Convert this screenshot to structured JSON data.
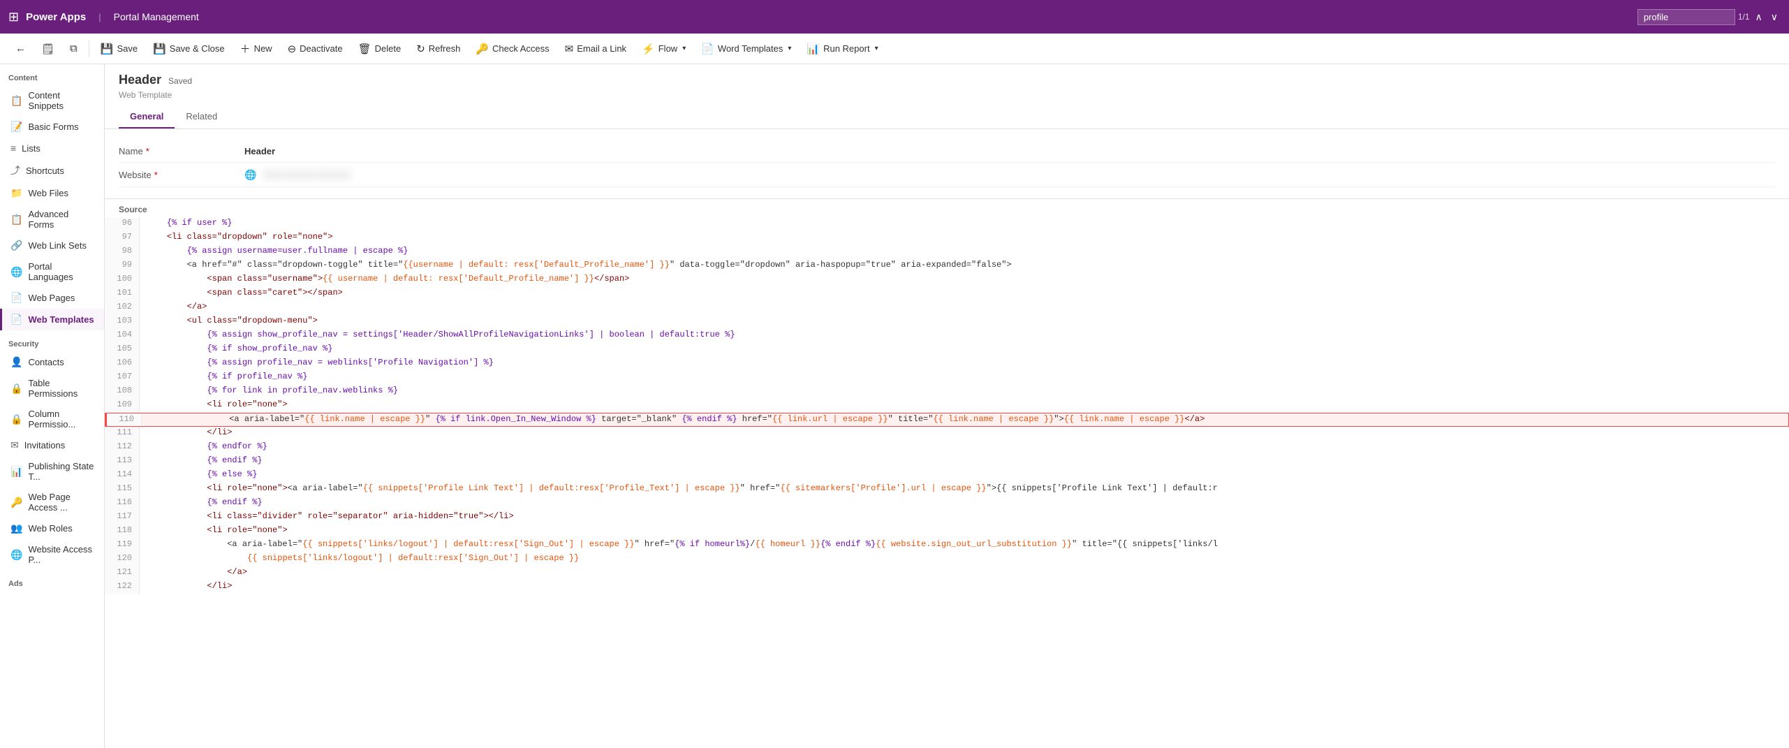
{
  "topBar": {
    "appsIcon": "⊞",
    "appName": "Power Apps",
    "separator": "|",
    "entityName": "Portal Management",
    "searchPlaceholder": "profile",
    "searchCount": "1/1"
  },
  "toolbar": {
    "back": "←",
    "notepad": "📄",
    "popout": "⧉",
    "save": "Save",
    "saveClose": "Save & Close",
    "new": "New",
    "deactivate": "Deactivate",
    "delete": "Delete",
    "refresh": "Refresh",
    "checkAccess": "Check Access",
    "emailLink": "Email a Link",
    "flow": "Flow",
    "wordTemplates": "Word Templates",
    "runReport": "Run Report"
  },
  "sidebar": {
    "contentSection": "Content",
    "items": [
      {
        "id": "content-snippets",
        "label": "Content Snippets",
        "icon": "📋"
      },
      {
        "id": "basic-forms",
        "label": "Basic Forms",
        "icon": "📝"
      },
      {
        "id": "lists",
        "label": "Lists",
        "icon": "≡"
      },
      {
        "id": "shortcuts",
        "label": "Shortcuts",
        "icon": "⤴"
      },
      {
        "id": "web-files",
        "label": "Web Files",
        "icon": "📁"
      },
      {
        "id": "advanced-forms",
        "label": "Advanced Forms",
        "icon": "📋"
      },
      {
        "id": "web-link-sets",
        "label": "Web Link Sets",
        "icon": "🔗"
      },
      {
        "id": "portal-languages",
        "label": "Portal Languages",
        "icon": "🌐"
      },
      {
        "id": "web-pages",
        "label": "Web Pages",
        "icon": "📄"
      },
      {
        "id": "web-templates",
        "label": "Web Templates",
        "icon": "📄",
        "active": true
      }
    ],
    "securitySection": "Security",
    "securityItems": [
      {
        "id": "contacts",
        "label": "Contacts",
        "icon": "👤"
      },
      {
        "id": "table-permissions",
        "label": "Table Permissions",
        "icon": "🔒"
      },
      {
        "id": "column-permissions",
        "label": "Column Permissio...",
        "icon": "🔒"
      },
      {
        "id": "invitations",
        "label": "Invitations",
        "icon": "✉"
      },
      {
        "id": "publishing-state",
        "label": "Publishing State T...",
        "icon": "📊"
      },
      {
        "id": "web-page-access",
        "label": "Web Page Access ...",
        "icon": "🔑"
      },
      {
        "id": "web-roles",
        "label": "Web Roles",
        "icon": "👥"
      },
      {
        "id": "website-access",
        "label": "Website Access P...",
        "icon": "🌐"
      }
    ],
    "adsSection": "Ads"
  },
  "record": {
    "title": "Header",
    "savedBadge": "Saved",
    "subtitle": "Web Template",
    "tabs": [
      "General",
      "Related"
    ],
    "activeTab": "General"
  },
  "form": {
    "nameLabel": "Name",
    "nameRequired": true,
    "nameValue": "Header",
    "websiteLabel": "Website",
    "websiteRequired": true,
    "websiteValue": "--- ------- -------"
  },
  "source": {
    "label": "Source",
    "lines": [
      {
        "num": 96,
        "content": "    {% if user %}",
        "highlight": false
      },
      {
        "num": 97,
        "content": "    <li class=\"dropdown\" role=\"none\">",
        "highlight": false
      },
      {
        "num": 98,
        "content": "        {% assign username=user.fullname | escape %}",
        "highlight": false
      },
      {
        "num": 99,
        "content": "        <a href=\"#\" class=\"dropdown-toggle\" title=\"{{username | default: resx['Default_Profile_name'] }}\" data-toggle=\"dropdown\" aria-haspopup=\"true\" aria-expanded=\"false\">",
        "highlight": false
      },
      {
        "num": 100,
        "content": "            <span class=\"username\">{{ username | default: resx['Default_Profile_name'] }}</span>",
        "highlight": false
      },
      {
        "num": 101,
        "content": "            <span class=\"caret\"></span>",
        "highlight": false
      },
      {
        "num": 102,
        "content": "        </a>",
        "highlight": false
      },
      {
        "num": 103,
        "content": "        <ul class=\"dropdown-menu\">",
        "highlight": false
      },
      {
        "num": 104,
        "content": "            {% assign show_profile_nav = settings['Header/ShowAllProfileNavigationLinks'] | boolean | default:true %}",
        "highlight": false
      },
      {
        "num": 105,
        "content": "            {% if show_profile_nav %}",
        "highlight": false
      },
      {
        "num": 106,
        "content": "            {% assign profile_nav = weblinks['Profile Navigation'] %}",
        "highlight": false
      },
      {
        "num": 107,
        "content": "            {% if profile_nav %}",
        "highlight": false
      },
      {
        "num": 108,
        "content": "            {% for link in profile_nav.weblinks %}",
        "highlight": false
      },
      {
        "num": 109,
        "content": "            <li role=\"none\">",
        "highlight": false
      },
      {
        "num": 110,
        "content": "                <a aria-label=\"{{ link.name | escape }}\" {% if link.Open_In_New_Window %} target=\"_blank\" {% endif %} href=\"{{ link.url | escape }}\" title=\"{{ link.name | escape }}\">{{ link.name | escape }}</a>",
        "highlight": true
      },
      {
        "num": 111,
        "content": "            </li>",
        "highlight": false
      },
      {
        "num": 112,
        "content": "            {% endfor %}",
        "highlight": false
      },
      {
        "num": 113,
        "content": "            {% endif %}",
        "highlight": false
      },
      {
        "num": 114,
        "content": "            {% else %}",
        "highlight": false
      },
      {
        "num": 115,
        "content": "            <li role=\"none\"><a aria-label=\"{{ snippets['Profile Link Text'] | default:resx['Profile_Text'] | escape }}\" href=\"{{ sitemarkers['Profile'].url | escape }}\">{{ snippets['Profile Link Text'] | default:r",
        "highlight": false
      },
      {
        "num": 116,
        "content": "            {% endif %}",
        "highlight": false
      },
      {
        "num": 117,
        "content": "            <li class=\"divider\" role=\"separator\" aria-hidden=\"true\"></li>",
        "highlight": false
      },
      {
        "num": 118,
        "content": "            <li role=\"none\">",
        "highlight": false
      },
      {
        "num": 119,
        "content": "                <a aria-label=\"{{ snippets['links/logout'] | default:resx['Sign_Out'] | escape }}\" href=\"{% if homeurl%}/{{ homeurl }}{% endif %}{{ website.sign_out_url_substitution }}\" title=\"{{ snippets['links/l",
        "highlight": false
      },
      {
        "num": 120,
        "content": "                    {{ snippets['links/logout'] | default:resx['Sign_Out'] | escape }}",
        "highlight": false
      },
      {
        "num": 121,
        "content": "                </a>",
        "highlight": false
      },
      {
        "num": 122,
        "content": "            </li>",
        "highlight": false
      }
    ]
  }
}
